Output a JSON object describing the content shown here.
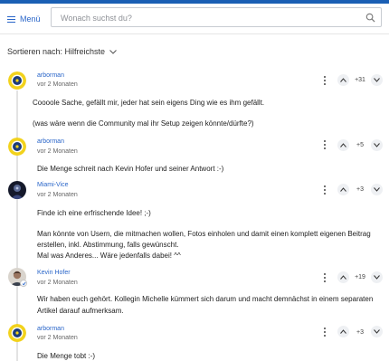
{
  "header": {
    "menu_label": "Menü",
    "search_placeholder": "Wonach suchst du?"
  },
  "sort": {
    "label": "Sortieren nach: Hilfreichste"
  },
  "colors": {
    "accent": "#1a5fb4",
    "link": "#2a66c9"
  },
  "comments": [
    {
      "author": "arborman",
      "date": "vor 2 Monaten",
      "votes": "+31",
      "avatar": "badge-yellow-blue",
      "lines": [
        "Coooole Sache, gefällt mir, jeder hat sein eigens Ding wie es ihm gefällt.",
        "",
        "(was wäre wenn die Community mal ihr Setup zeigen könnte/dürfte?)"
      ]
    },
    {
      "author": "arborman",
      "date": "vor 2 Monaten",
      "votes": "+5",
      "avatar": "badge-yellow-blue",
      "lines": [
        "Die Menge schreit nach Kevin Hofer und seiner Antwort :-)"
      ]
    },
    {
      "author": "Miami-Vice",
      "date": "vor 2 Monaten",
      "votes": "+3",
      "avatar": "dark-photo",
      "lines": [
        "Finde ich eine erfrischende Idee! ;-)",
        "",
        "Man könnte von Usern, die mitmachen wollen, Fotos einholen und damit einen komplett eigenen Beitrag",
        "erstellen, inkl. Abstimmung, falls gewünscht.",
        "Mal was Anderes... Wäre jedenfalls dabei! ^^"
      ]
    },
    {
      "author": "Kevin Hofer",
      "date": "vor 2 Monaten",
      "votes": "+19",
      "avatar": "person-photo",
      "lines": [
        "Wir haben euch gehört. Kollegin Michelle kümmert sich darum und macht demnächst in einem separaten",
        "Artikel darauf aufmerksam."
      ]
    },
    {
      "author": "arborman",
      "date": "vor 2 Monaten",
      "votes": "+3",
      "avatar": "badge-yellow-blue",
      "lines": [
        "Die Menge tobt :-)"
      ]
    }
  ]
}
